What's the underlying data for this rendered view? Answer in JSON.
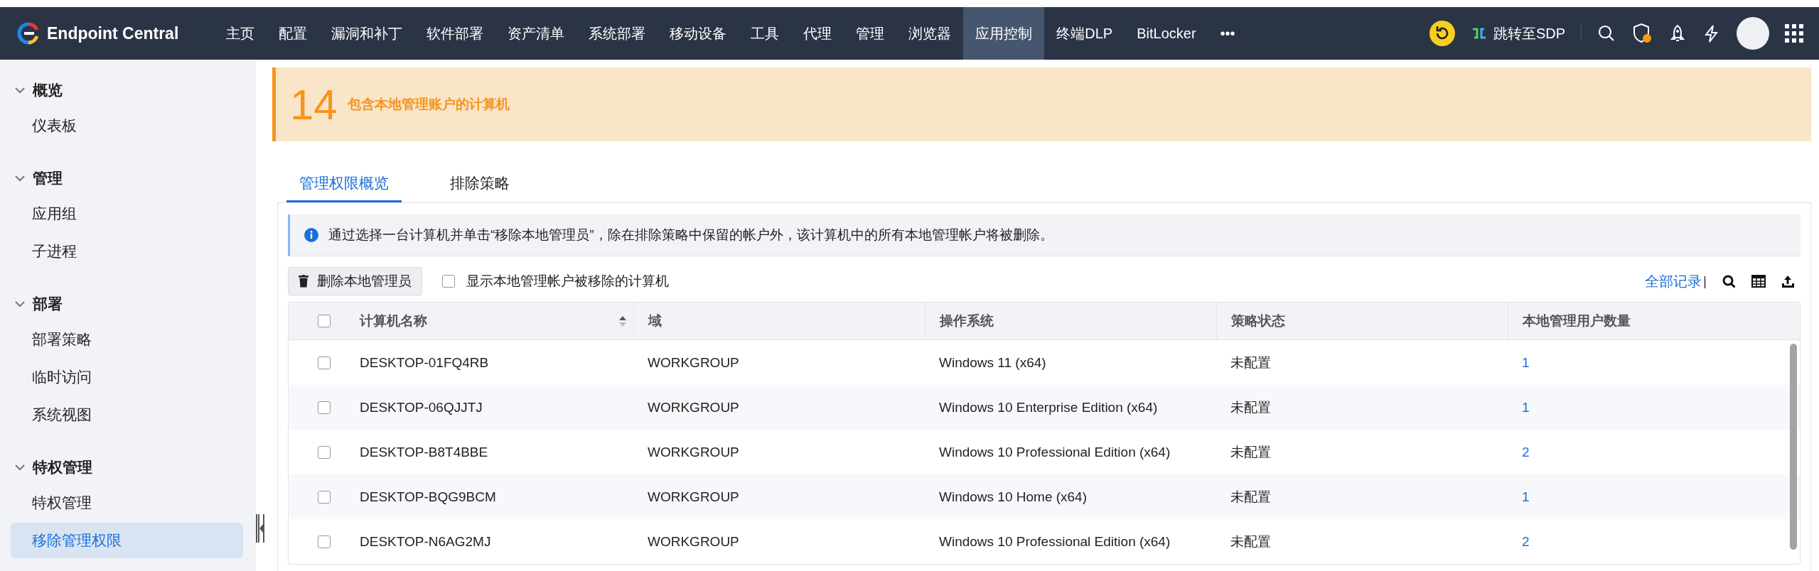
{
  "app": {
    "name": "Endpoint Central"
  },
  "nav": [
    {
      "label": "主页",
      "selected": false
    },
    {
      "label": "配置",
      "selected": false
    },
    {
      "label": "漏洞和补丁",
      "selected": false
    },
    {
      "label": "软件部署",
      "selected": false
    },
    {
      "label": "资产清单",
      "selected": false
    },
    {
      "label": "系统部署",
      "selected": false
    },
    {
      "label": "移动设备",
      "selected": false
    },
    {
      "label": "工具",
      "selected": false
    },
    {
      "label": "代理",
      "selected": false
    },
    {
      "label": "管理",
      "selected": false
    },
    {
      "label": "浏览器",
      "selected": false
    },
    {
      "label": "应用控制",
      "selected": true
    },
    {
      "label": "终端DLP",
      "selected": false
    },
    {
      "label": "BitLocker",
      "selected": false
    },
    {
      "label": "•••",
      "selected": false
    }
  ],
  "header_actions": {
    "jump_label": "跳转至SDP"
  },
  "sidebar": {
    "sections": [
      {
        "title": "概览",
        "expanded": true,
        "children": [
          {
            "label": "仪表板",
            "selected": false
          }
        ]
      },
      {
        "title": "管理",
        "expanded": true,
        "children": [
          {
            "label": "应用组",
            "selected": false
          },
          {
            "label": "子进程",
            "selected": false
          }
        ]
      },
      {
        "title": "部署",
        "expanded": true,
        "children": [
          {
            "label": "部署策略",
            "selected": false
          },
          {
            "label": "临时访问",
            "selected": false
          },
          {
            "label": "系统视图",
            "selected": false
          }
        ]
      },
      {
        "title": "特权管理",
        "expanded": true,
        "children": [
          {
            "label": "特权管理",
            "selected": false
          },
          {
            "label": "移除管理权限",
            "selected": true
          }
        ]
      }
    ]
  },
  "summary": {
    "count": "14",
    "label": "包含本地管理账户的计算机"
  },
  "tabs": [
    {
      "label": "管理权限概览",
      "selected": true
    },
    {
      "label": "排除策略",
      "selected": false
    }
  ],
  "info": "通过选择一台计算机并单击“移除本地管理员”，除在排除策略中保留的帐户外，该计算机中的所有本地管理帐户将被删除。",
  "toolbar": {
    "delete_button": "删除本地管理员",
    "show_removed": {
      "label": "显示本地管理帐户被移除的计算机",
      "checked": false
    },
    "all_records": "全部记录",
    "separator": "|"
  },
  "table": {
    "select_all_checked": false,
    "columns": [
      {
        "label": "计算机名称",
        "sortable": true
      },
      {
        "label": "域",
        "sortable": false
      },
      {
        "label": "操作系统",
        "sortable": false
      },
      {
        "label": "策略状态",
        "sortable": false
      },
      {
        "label": "本地管理用户数量",
        "sortable": false
      }
    ],
    "rows": [
      {
        "checked": false,
        "cells": [
          "DESKTOP-01FQ4RB",
          "WORKGROUP",
          "Windows 11 (x64)",
          "未配置",
          "1"
        ]
      },
      {
        "checked": false,
        "cells": [
          "DESKTOP-06QJJTJ",
          "WORKGROUP",
          "Windows 10 Enterprise Edition (x64)",
          "未配置",
          "1"
        ]
      },
      {
        "checked": false,
        "cells": [
          "DESKTOP-B8T4BBE",
          "WORKGROUP",
          "Windows 10 Professional Edition (x64)",
          "未配置",
          "2"
        ]
      },
      {
        "checked": false,
        "cells": [
          "DESKTOP-BQG9BCM",
          "WORKGROUP",
          "Windows 10 Home (x64)",
          "未配置",
          "1"
        ]
      },
      {
        "checked": false,
        "cells": [
          "DESKTOP-N6AG2MJ",
          "WORKGROUP",
          "Windows 10 Professional Edition (x64)",
          "未配置",
          "2"
        ]
      }
    ]
  }
}
